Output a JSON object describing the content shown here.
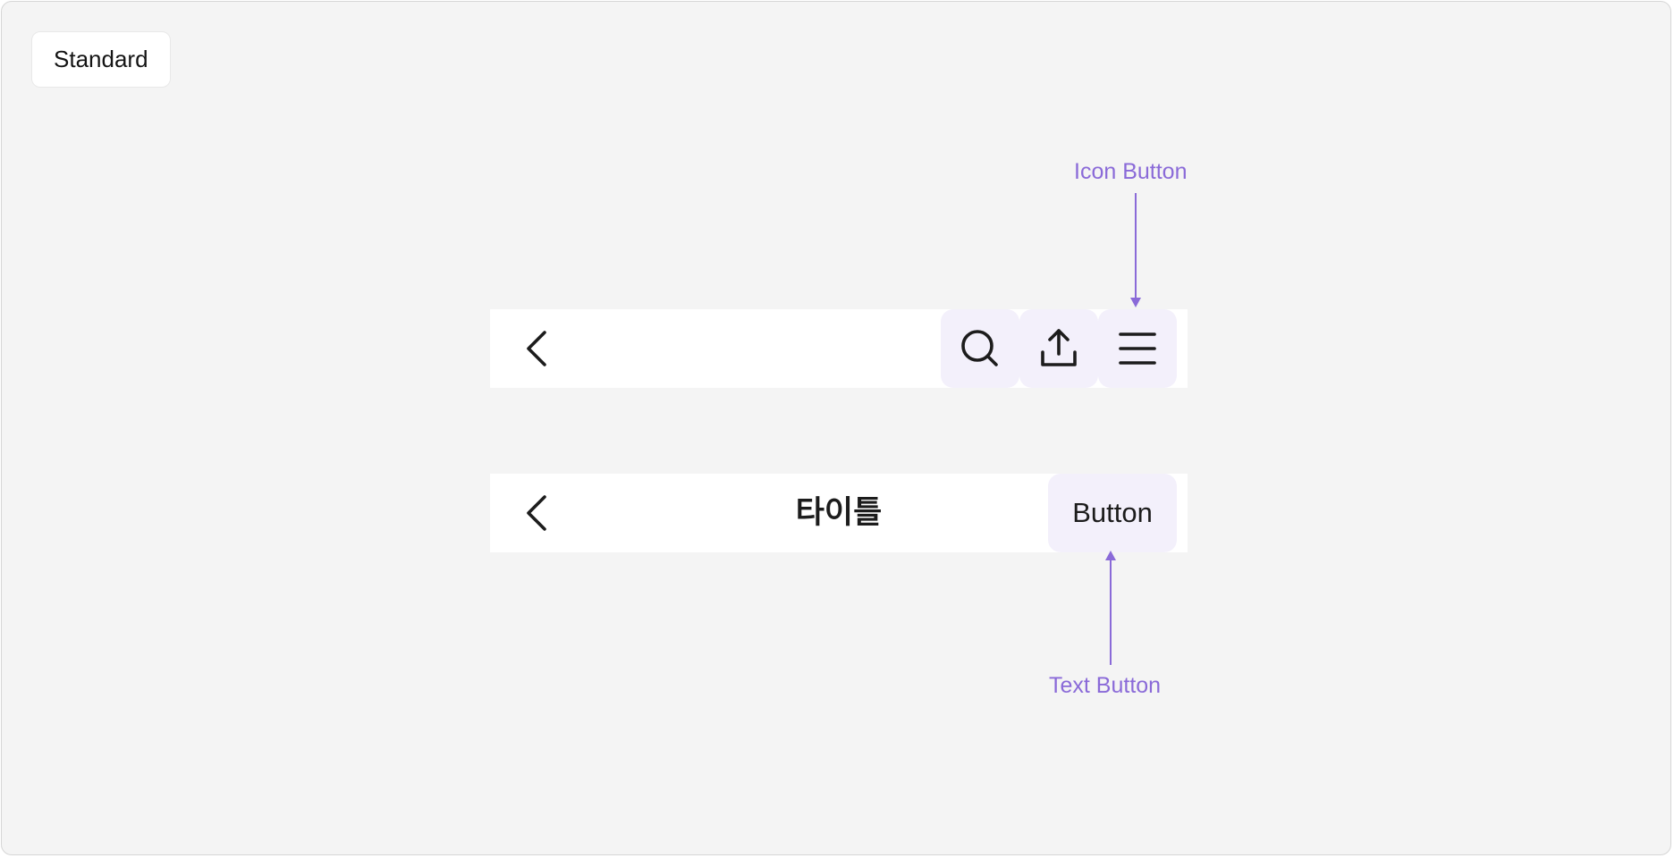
{
  "tag": {
    "label": "Standard"
  },
  "nav_bar_icons": {
    "back_icon": "chevron-left-icon",
    "actions": [
      {
        "icon": "search-icon"
      },
      {
        "icon": "upload-icon"
      },
      {
        "icon": "menu-icon"
      }
    ]
  },
  "nav_bar_text": {
    "back_icon": "chevron-left-icon",
    "title": "타이틀",
    "button_label": "Button"
  },
  "annotations": {
    "icon_button": "Icon Button",
    "text_button": "Text Button"
  },
  "colors": {
    "canvas": "#f4f4f4",
    "bar": "#ffffff",
    "button_bg": "#f3f0fb",
    "accent": "#8a6ad8",
    "icon": "#1c1c1c"
  }
}
